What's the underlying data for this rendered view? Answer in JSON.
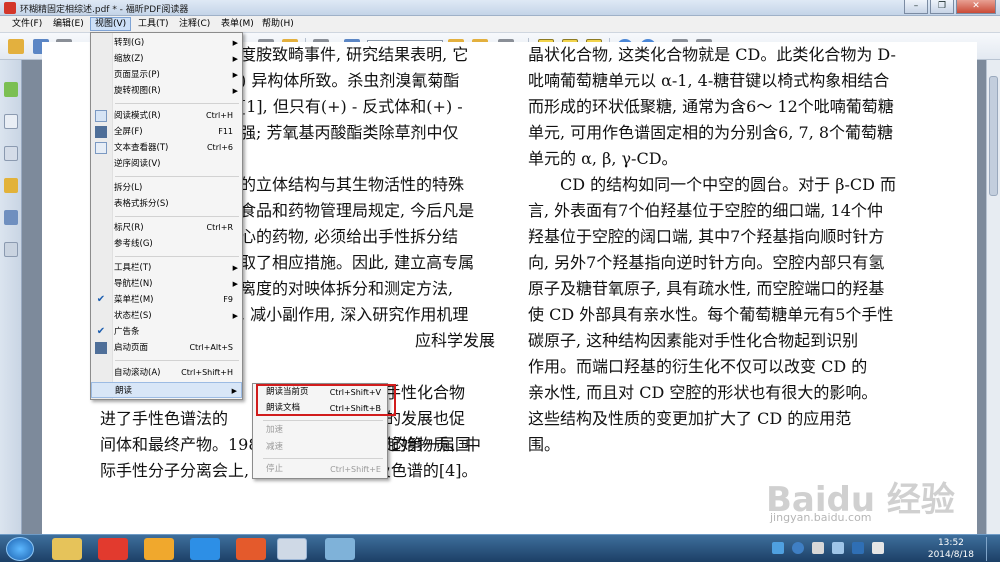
{
  "window": {
    "title": "环糊精固定相综述.pdf * - 福昕PDF阅读器"
  },
  "menubar": [
    {
      "label": "文件(F)"
    },
    {
      "label": "编辑(E)"
    },
    {
      "label": "视图(V)"
    },
    {
      "label": "工具(T)"
    },
    {
      "label": "注释(C)"
    },
    {
      "label": "表单(M)"
    },
    {
      "label": "帮助(H)"
    }
  ],
  "view_menu": [
    {
      "label": "转到(G)",
      "submenu": true
    },
    {
      "label": "缩放(Z)",
      "submenu": true
    },
    {
      "label": "页面显示(P)",
      "submenu": true
    },
    {
      "label": "旋转视图(R)",
      "submenu": true
    },
    {
      "label": "阅读模式(R)",
      "shortcut": "Ctrl+H",
      "icon": "reading-mode-icon"
    },
    {
      "label": "全屏(F)",
      "shortcut": "F11",
      "icon": "fullscreen-icon"
    },
    {
      "label": "文本查看器(T)",
      "shortcut": "Ctrl+6",
      "icon": "text-viewer-icon"
    },
    {
      "label": "逆序阅读(V)"
    },
    {
      "label": "拆分(L)"
    },
    {
      "label": "表格式拆分(S)"
    },
    {
      "label": "标尺(R)",
      "shortcut": "Ctrl+R"
    },
    {
      "label": "参考线(G)"
    },
    {
      "label": "工具栏(T)",
      "submenu": true
    },
    {
      "label": "导航栏(N)",
      "submenu": true
    },
    {
      "label": "菜单栏(M)",
      "shortcut": "F9",
      "checked": true
    },
    {
      "label": "状态栏(S)",
      "submenu": true
    },
    {
      "label": "广告条",
      "checked": true
    },
    {
      "label": "启动页面",
      "shortcut": "Ctrl+Alt+S",
      "icon": "start-page-icon"
    },
    {
      "label": "自动滚动(A)",
      "shortcut": "Ctrl+Shift+H"
    },
    {
      "label": "朗读",
      "submenu": true,
      "highlighted": true
    }
  ],
  "read_aloud_submenu": [
    {
      "label": "朗读当前页",
      "shortcut": "Ctrl+Shift+V"
    },
    {
      "label": "朗读文档",
      "shortcut": "Ctrl+Shift+B"
    },
    {
      "label": "加速",
      "disabled": true
    },
    {
      "label": "减速",
      "disabled": true
    },
    {
      "label": "停止",
      "shortcut": "Ctrl+Shift+E",
      "disabled": true
    }
  ],
  "document": {
    "left_column": [
      "度胺致畸事件, 研究结果表明, 它",
      ") 异构体所致。杀虫剂溴氰菊酯",
      "[1], 但只有(+) - 反式体和(+) -",
      "强; 芳氧基丙酸酯类除草剂中仅",
      "",
      "的立体结构与其生物活性的特殊",
      "食品和药物管理局规定, 今后凡是",
      "心的药物, 必须给出手性拆分结",
      "取了相应措施。因此, 建立高专属",
      "离度的对映体拆分和测定方法,",
      ", 减小副作用, 深入研究作用机理",
      "应科学发展",
      "的需要, 科学家们",
      "的色谱分离方法的",
      "进了手性色谱法的",
      "间体和最终产物。1988年6月在巴黎召开的第一届国",
      "际手性分子分离会上, 90% 的文章是涉及色谱的[4]。"
    ],
    "left_column_right_fragments": [
      "手性化合物",
      "的发展也促",
      "起始物质、中"
    ],
    "right_column": [
      "晶状化合物, 这类化合物就是 CD。此类化合物为 D-",
      "吡喃葡萄糖单元以 α-1, 4-糖苷键以椅式构象相结合",
      "而形成的环状低聚糖, 通常为含6～ 12个吡喃葡萄糖",
      "单元, 可用作色谱固定相的为分别含6, 7, 8个葡萄糖",
      "单元的 α, β, γ-CD。",
      "CD 的结构如同一个中空的圆台。对于 β-CD 而",
      "言, 外表面有7个伯羟基位于空腔的细口端, 14个仲",
      "羟基位于空腔的阔口端, 其中7个羟基指向顺时针方",
      "向, 另外7个羟基指向逆时针方向。空腔内部只有氢",
      "原子及糖苷氧原子, 具有疏水性, 而空腔端口的羟基",
      "使 CD 外部具有亲水性。每个葡萄糖单元有5个手性",
      "碳原子, 这种结构因素能对手性化合物起到识别",
      "作用。而端口羟基的衍生化不仅可以改变 CD 的",
      "亲水性, 而且对 CD 空腔的形状也有很大的影响。",
      "这些结构及性质的变更加扩大了 CD 的应用范",
      "围。"
    ]
  },
  "watermark": {
    "text": "Baidu 经验",
    "url": "jingyan.baidu.com"
  },
  "taskbar": {
    "time": "13:52",
    "date": "2014/8/18"
  },
  "colors": {
    "highlight_box": "#d11c1c",
    "menu_hover": "#d8e6f7",
    "taskbar": "#2b5a8a"
  }
}
